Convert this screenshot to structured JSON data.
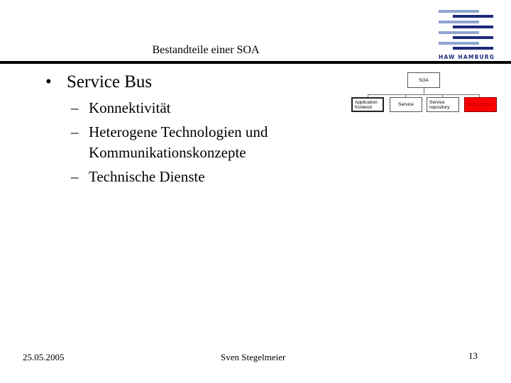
{
  "header": {
    "title": "Bestandteile einer SOA",
    "logo_text": "HAW HAMBURG"
  },
  "content": {
    "bullet": "Service Bus",
    "subitems": [
      {
        "lines": [
          "Konnektivität"
        ]
      },
      {
        "lines": [
          "Heterogene Technologien und",
          "Kommunikationskonzepte"
        ]
      },
      {
        "lines": [
          "Technische Dienste"
        ]
      }
    ],
    "bullet_glyph": "•",
    "dash_glyph": "–"
  },
  "diagram": {
    "root": "SOA",
    "children": [
      {
        "label": "Application frontend",
        "highlighted": false
      },
      {
        "label": "Service",
        "highlighted": false
      },
      {
        "label": "Service repository",
        "highlighted": false
      },
      {
        "label": "Service bus",
        "highlighted": true
      }
    ],
    "highlight_color": "#ff0000"
  },
  "footer": {
    "date": "25.05.2005",
    "author": "Sven Stegelmeier",
    "page": "13"
  }
}
